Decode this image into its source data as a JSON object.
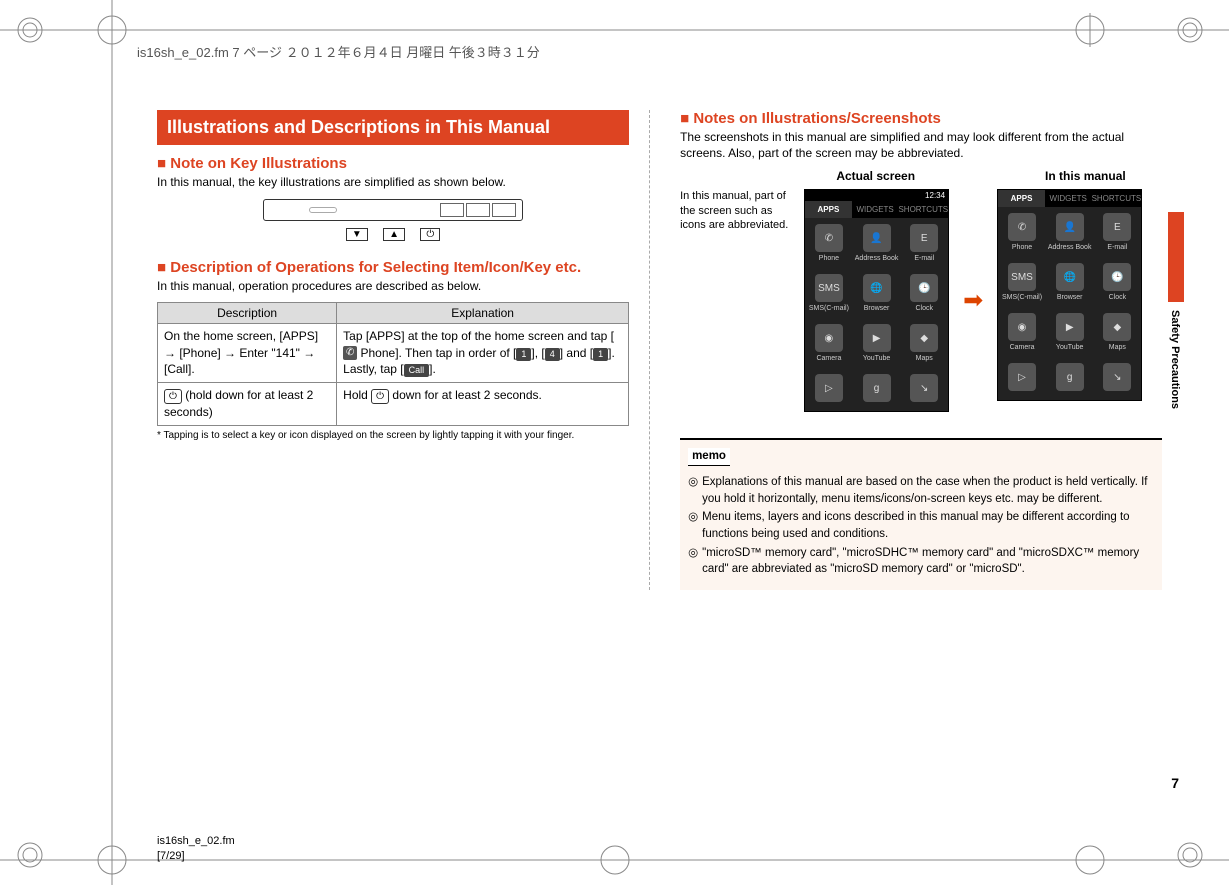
{
  "header_line": "is16sh_e_02.fm  7 ページ  ２０１２年６月４日 月曜日 午後３時３１分",
  "left": {
    "title": "Illustrations and Descriptions in This Manual",
    "sub1": "Note on Key Illustrations",
    "sub1_text": "In this manual, the key illustrations are simplified as shown below.",
    "keys": {
      "a": "▼",
      "b": "▲",
      "c": "⏻"
    },
    "sub2": "Description of Operations for Selecting Item/Icon/Key etc.",
    "sub2_text": "In this manual, operation procedures are described as below.",
    "table": {
      "h1": "Description",
      "h2": "Explanation",
      "r1c1": "On the home screen, [APPS] → [Phone] → Enter \"141\" → [Call].",
      "r1c2_a": "Tap [APPS] at the top of the home screen and tap [",
      "r1c2_b": " Phone]. Then tap in order of [",
      "r1c2_c": "], [",
      "r1c2_d": "] and [",
      "r1c2_e": "]. Lastly, tap [",
      "r1c2_f": "].",
      "key1": "1",
      "key4": "4",
      "key1b": "1",
      "keycall": "Call",
      "r2c1_a": "⏻",
      "r2c1_b": " (hold down for at least 2 seconds)",
      "r2c2_a": "Hold ",
      "r2c2_b": "⏻",
      "r2c2_c": " down for at least 2 seconds."
    },
    "footnote": "* Tapping is to select a key or icon displayed on the screen by lightly tapping it with your finger."
  },
  "right": {
    "sub": "Notes on Illustrations/Screenshots",
    "text": "The screenshots in this manual are simplified and may look different from the actual screens. Also, part of the screen may be abbreviated.",
    "label1": "Actual screen",
    "label2": "In this manual",
    "side_note": "In this manual, part of the screen such as icons are abbreviated.",
    "status_time": "12:34",
    "tabs": {
      "a": "APPS",
      "b": "WIDGETS",
      "c": "SHORTCUTS"
    },
    "apps": {
      "phone": "Phone",
      "addr": "Address Book",
      "email": "E-mail",
      "sms": "SMS(C-mail)",
      "browser": "Browser",
      "clock": "Clock",
      "camera": "Camera",
      "youtube": "YouTube",
      "maps": "Maps"
    },
    "memo_title": "memo",
    "memo": {
      "i1": "Explanations of this manual are based on the case when the product is held vertically. If you hold it horizontally, menu items/icons/on-screen keys etc. may be different.",
      "i2": "Menu items, layers and icons described in this manual may be different according to functions being used and conditions.",
      "i3": "\"microSD™ memory card\", \"microSDHC™ memory card\" and \"microSDXC™ memory card\" are abbreviated as \"microSD memory card\" or \"microSD\"."
    }
  },
  "side_text": "Safety Precautions",
  "page_num": "7",
  "footer": {
    "l1": "is16sh_e_02.fm",
    "l2": "[7/29]"
  }
}
